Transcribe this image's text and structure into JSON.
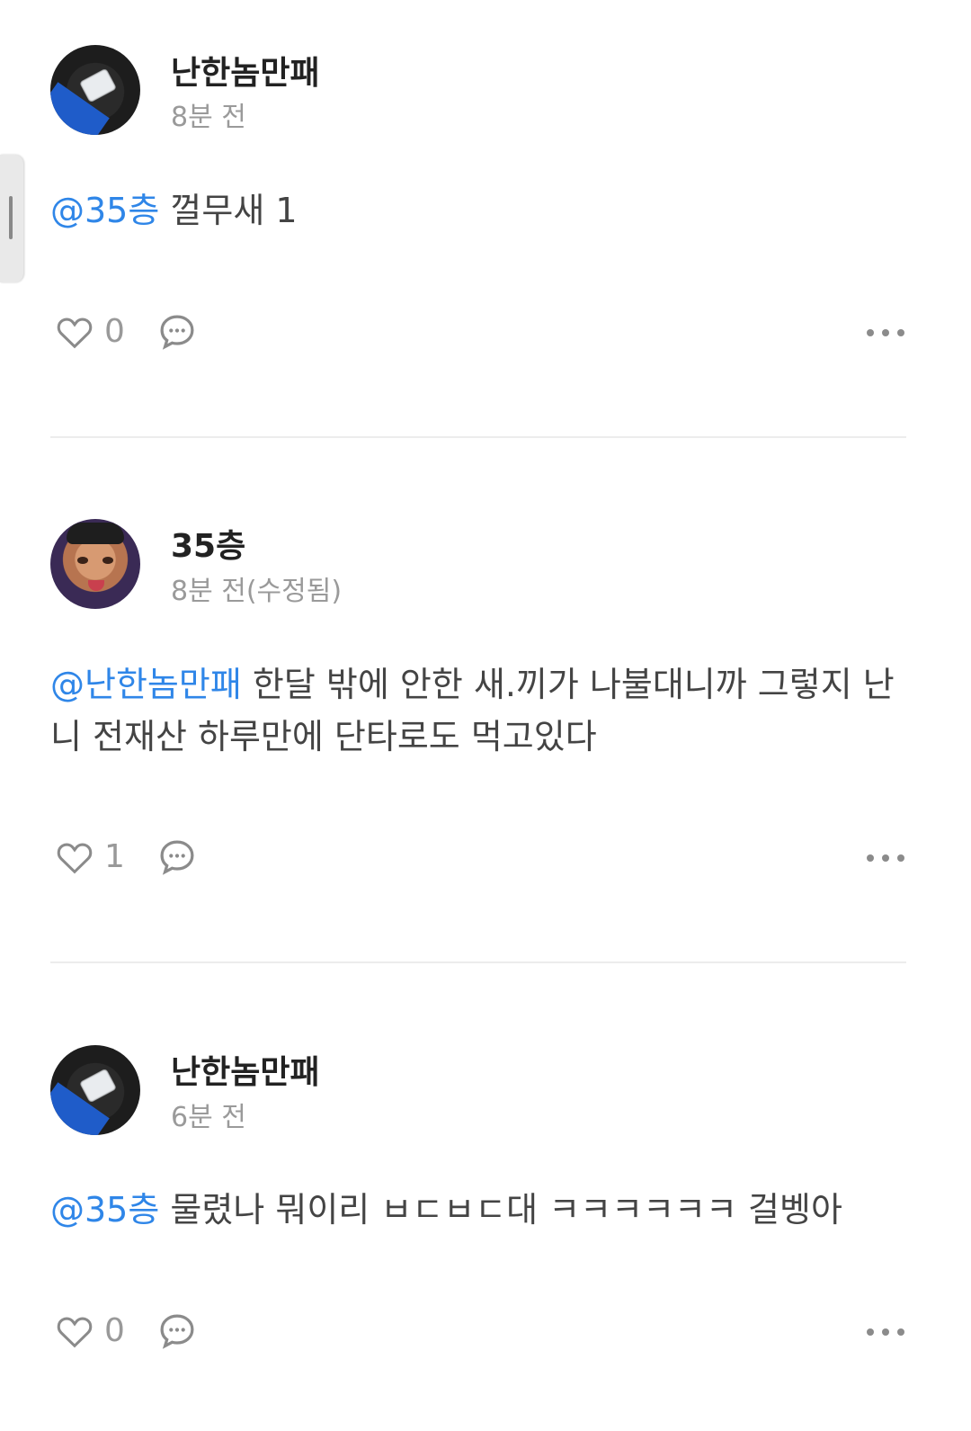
{
  "comments": [
    {
      "username": "난한놈만패",
      "time": "8분 전",
      "mention": "@35층",
      "text": " 껄무새 1",
      "likes": "0",
      "avatar": "fabric-tag-avatar"
    },
    {
      "username": "35층",
      "time": "8분 전(수정됨)",
      "mention": "@난한놈만패",
      "text": " 한달 밖에 안한 새.끼가 나불대니까 그렇지 난 니 전재산 하루만에 단타로도 먹고있다",
      "likes": "1",
      "avatar": "face-avatar"
    },
    {
      "username": "난한놈만패",
      "time": "6분 전",
      "mention": "@35층",
      "text": " 물렸나 뭐이리 ㅂㄷㅂㄷ대 ㅋㅋㅋㅋㅋㅋ 걸벵아",
      "likes": "0",
      "avatar": "fabric-tag-avatar"
    }
  ],
  "colors": {
    "mention": "#2f86e8",
    "username": "#222222",
    "meta": "#9a9a9a",
    "divider": "#ececec"
  },
  "icons": [
    "heart-icon",
    "reply-bubble-icon",
    "more-dots-icon"
  ]
}
